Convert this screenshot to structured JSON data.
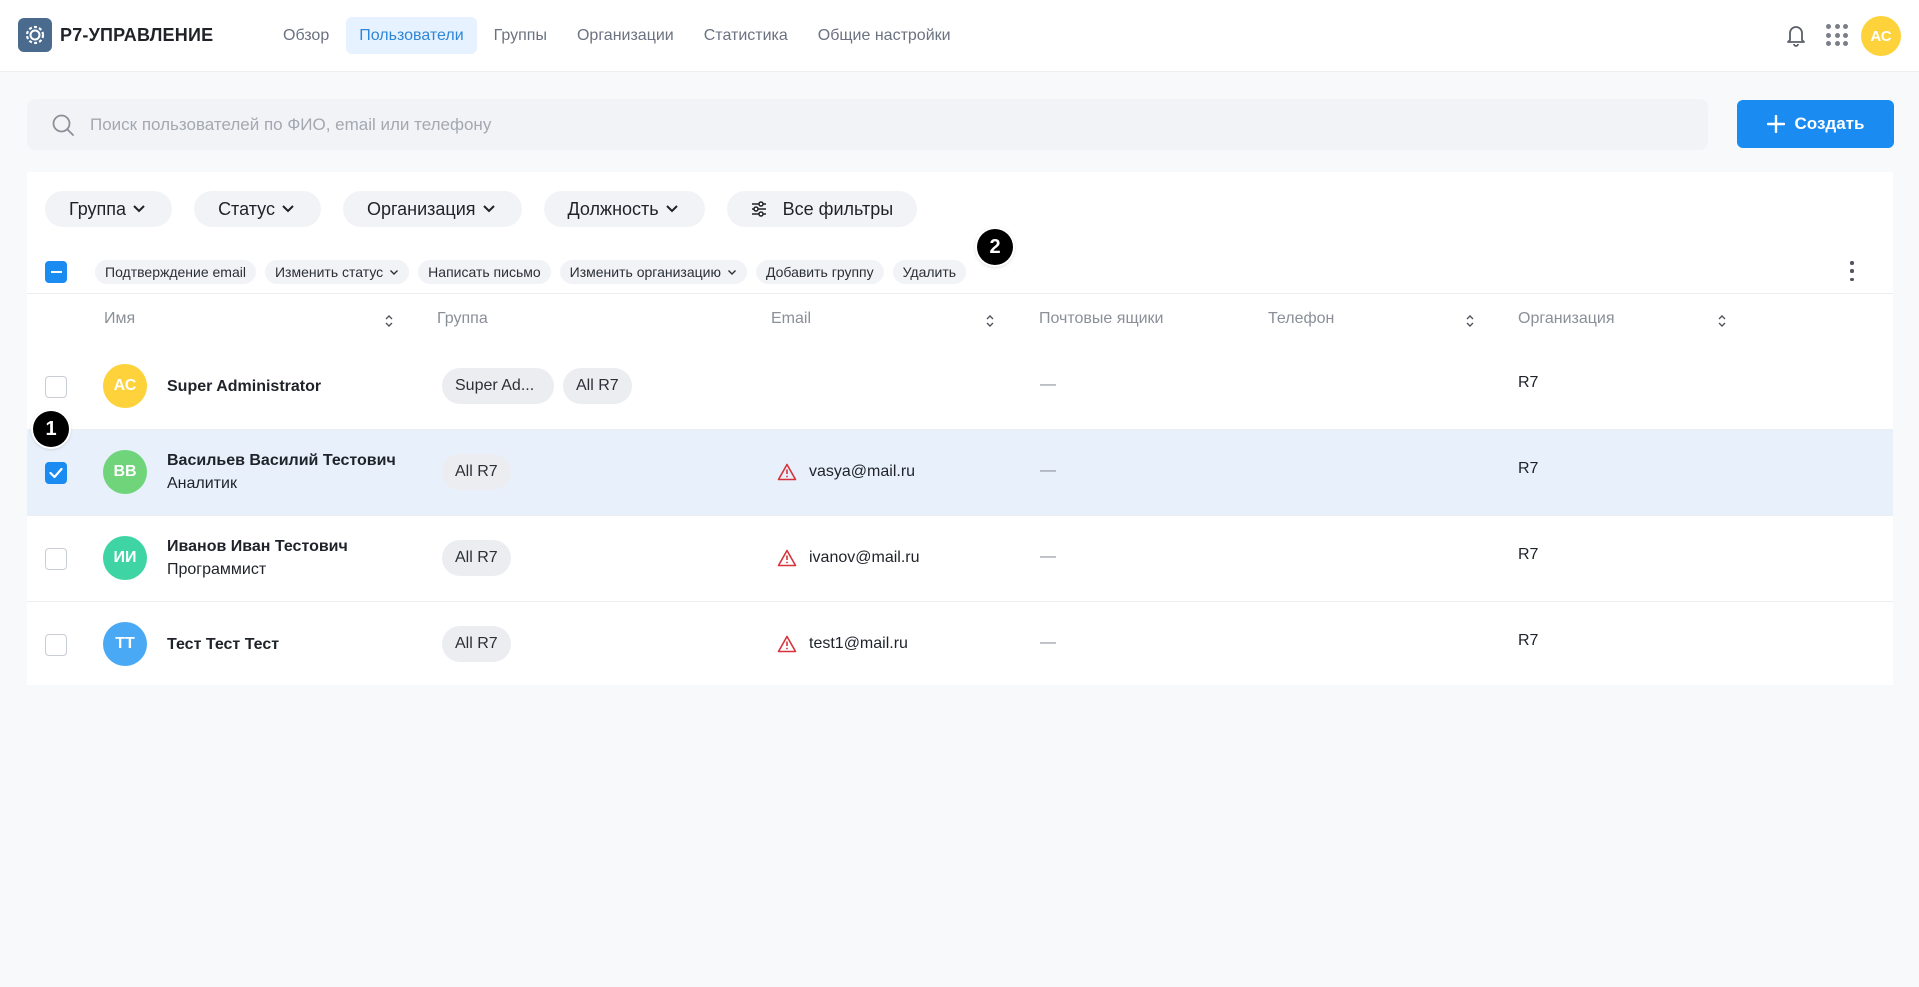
{
  "app": {
    "brand": "Р7-УПРАВЛЕНИЕ"
  },
  "nav": [
    {
      "label": "Обзор",
      "active": false
    },
    {
      "label": "Пользователи",
      "active": true
    },
    {
      "label": "Группы",
      "active": false
    },
    {
      "label": "Организации",
      "active": false
    },
    {
      "label": "Статистика",
      "active": false
    },
    {
      "label": "Общие настройки",
      "active": false
    }
  ],
  "header": {
    "avatar_initials": "АС",
    "avatar_color": "#fdd23a"
  },
  "search": {
    "placeholder": "Поиск пользователей по ФИО, email или телефону",
    "value": ""
  },
  "create_button": {
    "label": "Создать"
  },
  "filters": {
    "group": "Группа",
    "status": "Статус",
    "organization": "Организация",
    "position": "Должность",
    "all": "Все фильтры"
  },
  "bulk_actions": {
    "confirm_email": "Подтверждение email",
    "change_status": "Изменить статус",
    "write_letter": "Написать письмо",
    "change_org": "Изменить организацию",
    "add_group": "Добавить группу",
    "delete": "Удалить"
  },
  "columns": {
    "name": "Имя",
    "group": "Группа",
    "email": "Email",
    "mailboxes": "Почтовые ящики",
    "phone": "Телефон",
    "organization": "Организация"
  },
  "rows": [
    {
      "initials": "АС",
      "avatar_color": "#fdd23a",
      "name": "Super Administrator",
      "role": "",
      "groups": [
        "Super Ad...",
        "All R7"
      ],
      "email": "",
      "email_warning": false,
      "mailboxes": "—",
      "phone": "",
      "organization": "R7",
      "selected": false
    },
    {
      "initials": "ВВ",
      "avatar_color": "#6fd47a",
      "name": "Васильев Василий Тестович",
      "role": "Аналитик",
      "groups": [
        "All R7"
      ],
      "email": "vasya@mail.ru",
      "email_warning": true,
      "mailboxes": "—",
      "phone": "",
      "organization": "R7",
      "selected": true
    },
    {
      "initials": "ИИ",
      "avatar_color": "#3fd4a3",
      "name": "Иванов Иван Тестович",
      "role": "Программист",
      "groups": [
        "All R7"
      ],
      "email": "ivanov@mail.ru",
      "email_warning": true,
      "mailboxes": "—",
      "phone": "",
      "organization": "R7",
      "selected": false
    },
    {
      "initials": "ТТ",
      "avatar_color": "#4aa9f5",
      "name": "Тест Тест Тест",
      "role": "",
      "groups": [
        "All R7"
      ],
      "email": "test1@mail.ru",
      "email_warning": true,
      "mailboxes": "—",
      "phone": "",
      "organization": "R7",
      "selected": false
    }
  ],
  "annotations": {
    "one": "1",
    "two": "2"
  },
  "colors": {
    "accent": "#1a8bf0",
    "active_nav_bg": "#e6f2ff",
    "selected_row": "#e8f0fb",
    "warning": "#d6333a"
  }
}
